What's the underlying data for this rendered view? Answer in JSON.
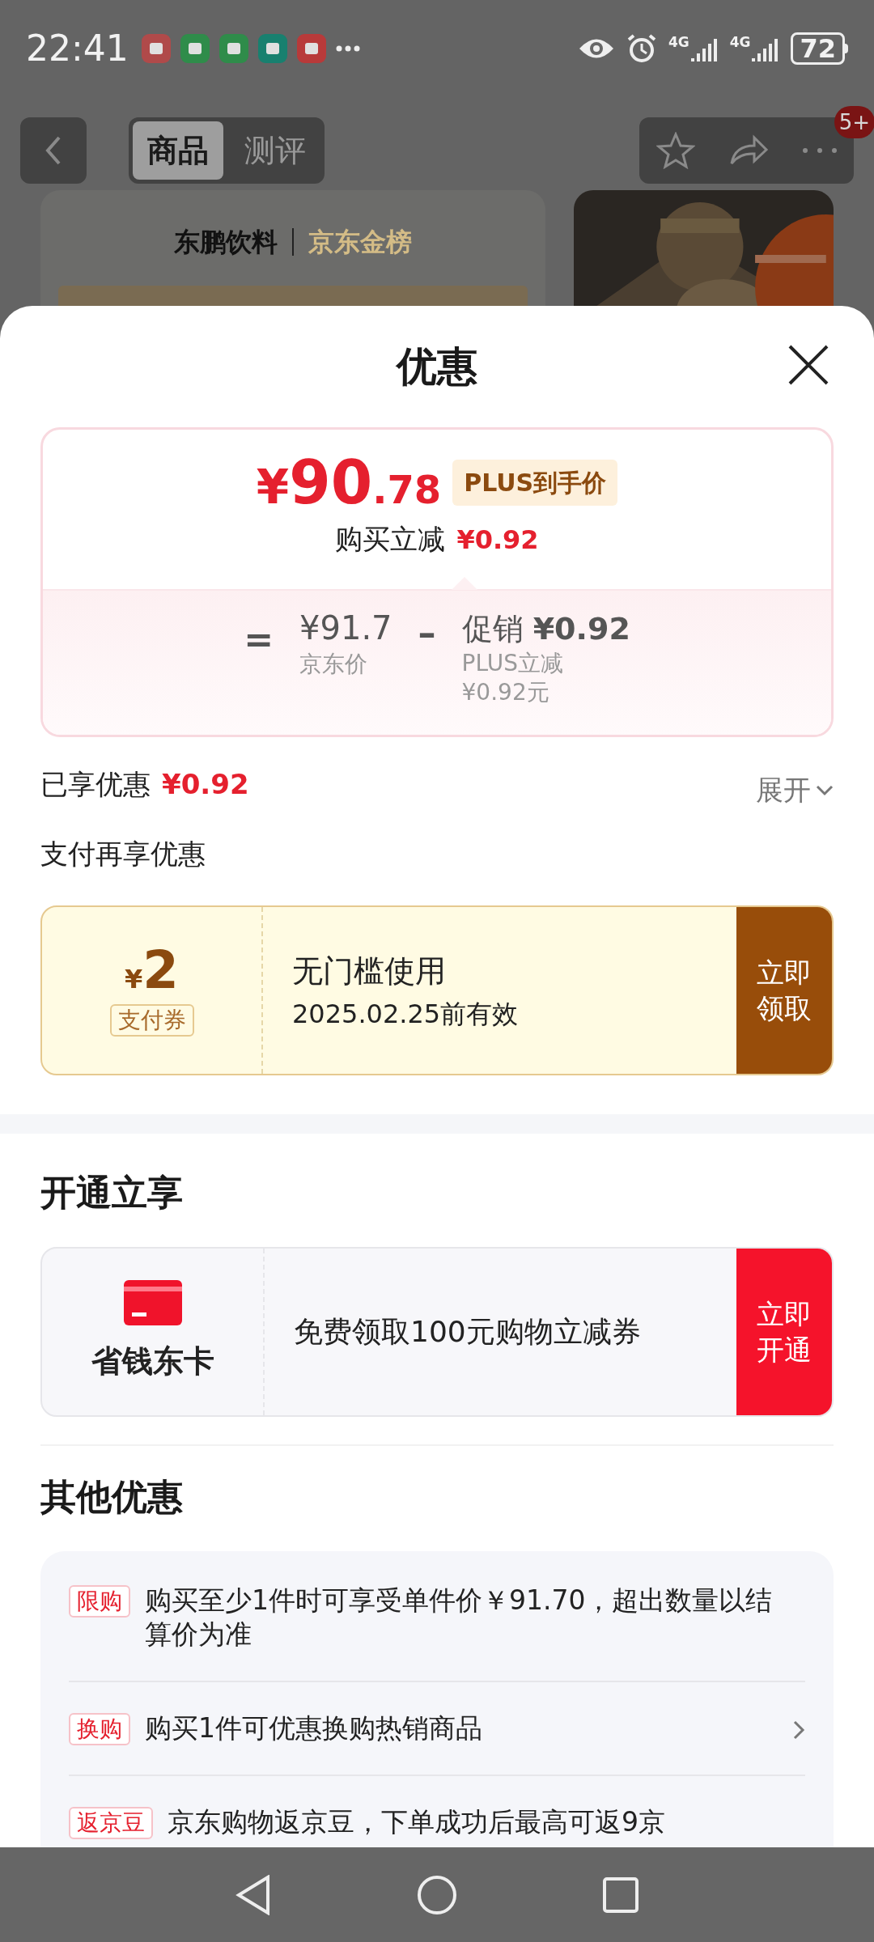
{
  "status_bar": {
    "time": "22:41",
    "network_labels": [
      "4G",
      "4G"
    ],
    "battery": "72"
  },
  "background_page": {
    "tabs": [
      {
        "label": "商品",
        "selected": true
      },
      {
        "label": "测评",
        "selected": false
      }
    ],
    "badge": "5+",
    "banner": {
      "brand": "东鹏饮料",
      "partner": "京东金榜"
    }
  },
  "sheet": {
    "title": "优惠",
    "price_card": {
      "currency": "¥",
      "integer": "90",
      "decimal": ".78",
      "tag": "PLUS到手价",
      "reduction_label": "购买立减",
      "reduction_value": "¥0.92",
      "equals": "=",
      "base_price": "¥91.7",
      "base_label": "京东价",
      "minus": "–",
      "promo_label": "促销",
      "promo_value": "¥0.92",
      "promo_detail": "PLUS立减",
      "promo_detail_amount": "¥0.92元"
    },
    "enjoyed": {
      "label": "已享优惠",
      "value": "¥0.92",
      "expand": "展开"
    },
    "pay_section": {
      "title": "支付再享优惠",
      "coupon": {
        "currency": "¥",
        "amount": "2",
        "tag": "支付券",
        "title": "无门槛使用",
        "validity": "2025.02.25前有效",
        "button": "立即领取"
      }
    },
    "open_section": {
      "title": "开通立享",
      "card": {
        "name": "省钱东卡",
        "description": "免费领取100元购物立减券",
        "button": "立即开通"
      }
    },
    "other_section": {
      "title": "其他优惠",
      "items": [
        {
          "tag": "限购",
          "text": "购买至少1件时可享受单件价￥91.70，超出数量以结算价为准",
          "arrow": false
        },
        {
          "tag": "换购",
          "text": "购买1件可优惠换购热销商品",
          "arrow": true
        },
        {
          "tag": "返京豆",
          "text": "京东购物返京豆，下单成功后最高可返9京",
          "arrow": false
        }
      ]
    }
  }
}
